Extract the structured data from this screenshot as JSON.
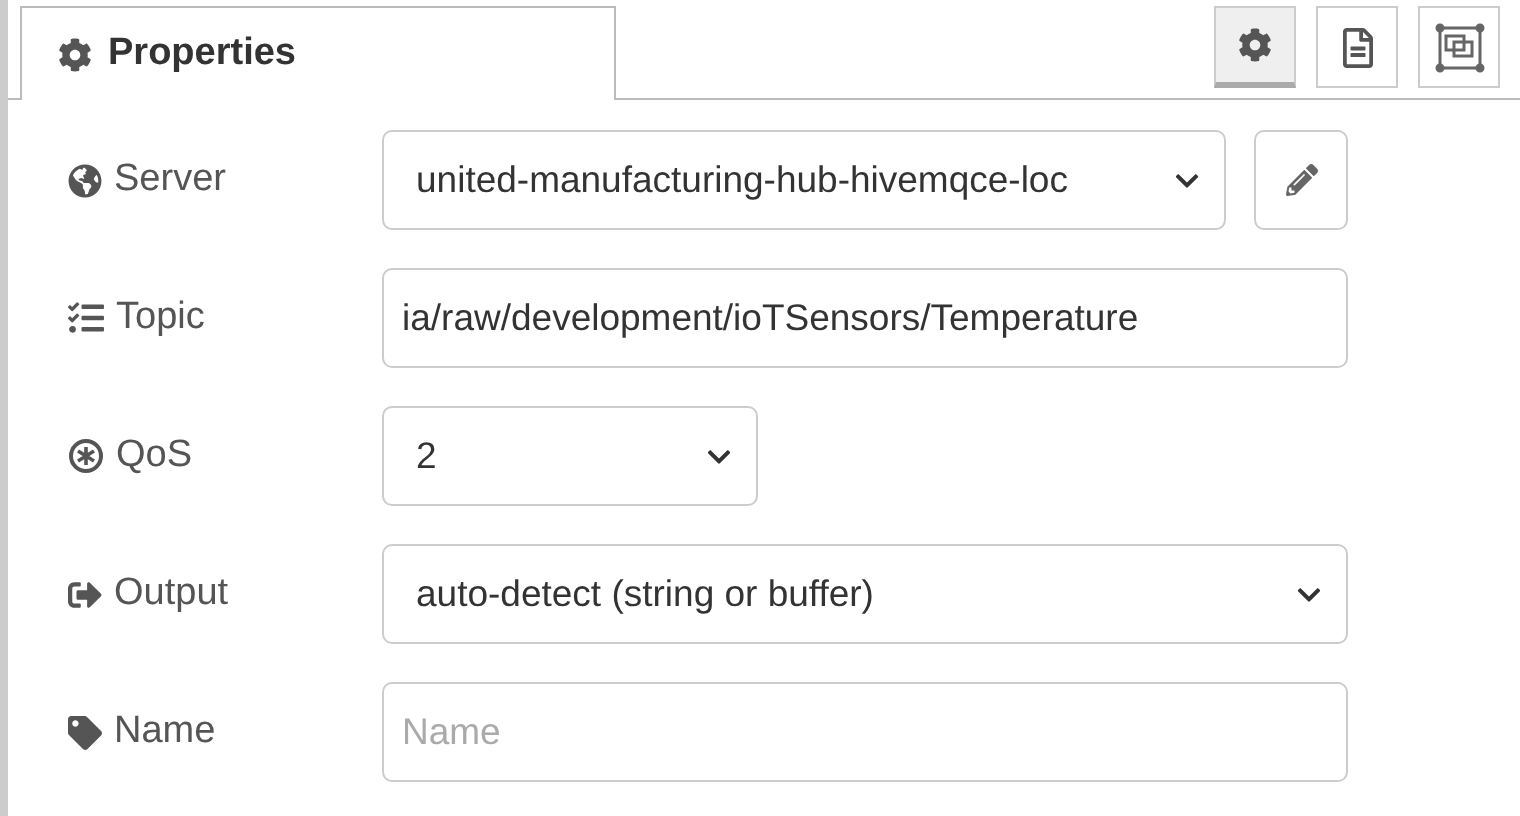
{
  "tab": {
    "label": "Properties",
    "selected": true
  },
  "toolbar": [
    {
      "selected": true
    },
    {
      "selected": false
    },
    {
      "selected": false
    }
  ],
  "fields": [
    {
      "label": "Server",
      "kind": "select",
      "value": "united-manufacturing-hub-hivemqce-loc",
      "editable": true
    },
    {
      "label": "Topic",
      "kind": "input",
      "value": "ia/raw/development/ioTSensors/Temperature"
    },
    {
      "label": "QoS",
      "kind": "select",
      "value": "2"
    },
    {
      "label": "Output",
      "kind": "select",
      "value": "auto-detect (string or buffer)"
    },
    {
      "label": "Name",
      "kind": "input",
      "placeholder": "Name"
    }
  ]
}
